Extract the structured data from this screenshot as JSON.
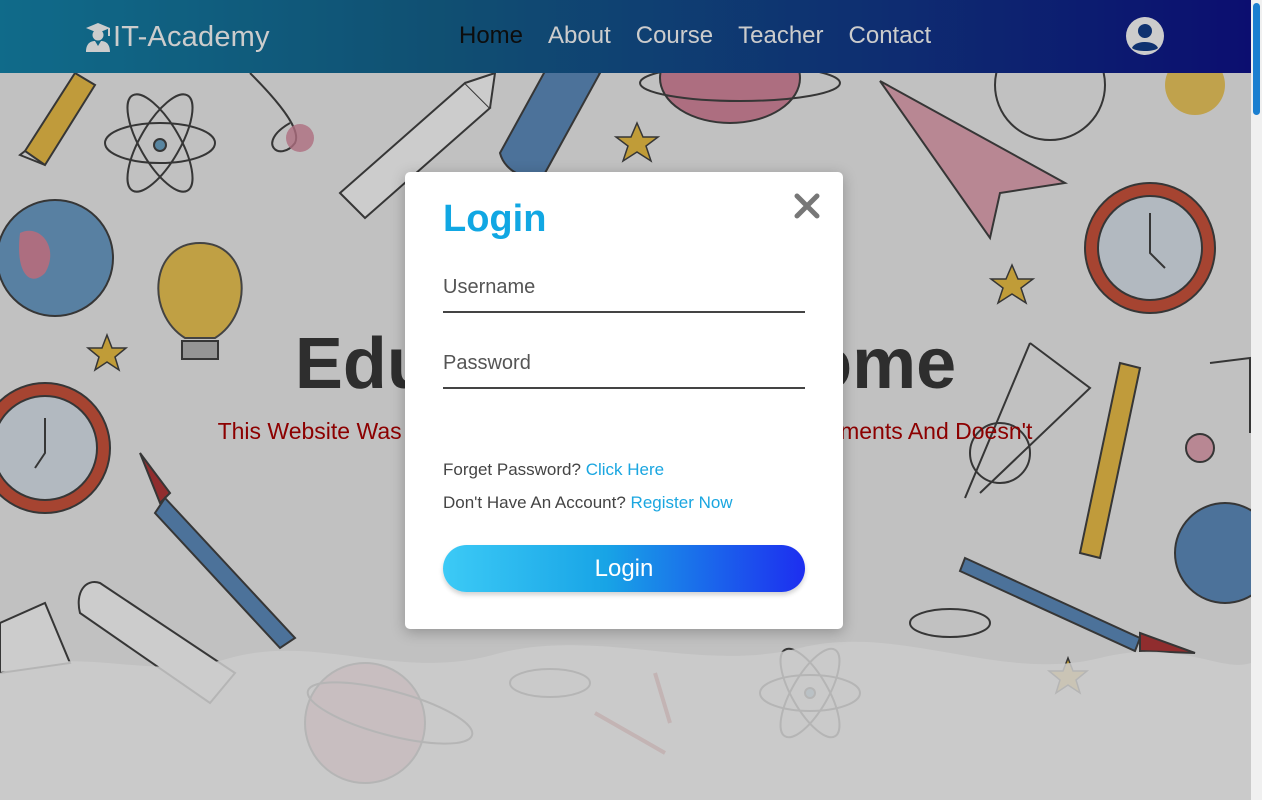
{
  "header": {
    "brand": "IT-Academy",
    "logo_icon": "graduate-icon",
    "nav": [
      {
        "label": "Home",
        "active": true
      },
      {
        "label": "About",
        "active": false
      },
      {
        "label": "Course",
        "active": false
      },
      {
        "label": "Teacher",
        "active": false
      },
      {
        "label": "Contact",
        "active": false
      }
    ],
    "profile_icon": "user-circle-icon"
  },
  "hero": {
    "title": "Education At Home",
    "subtitle": "This Website Was Created By Based On Our Clients Requirements And Doesn't Include Any Third Party Service"
  },
  "login_modal": {
    "title": "Login",
    "close_icon": "close-icon",
    "username_placeholder": "Username",
    "password_placeholder": "Password",
    "forgot_text": "Forget Password?",
    "forgot_link": "Click Here",
    "register_text": "Don't Have An Account?",
    "register_link": "Register Now",
    "submit_label": "Login"
  },
  "colors": {
    "accent": "#11a7e3",
    "link": "#1aa6e0",
    "subtitle_red": "#b00000",
    "header_start": "#1486ad",
    "header_end": "#0f128c"
  }
}
